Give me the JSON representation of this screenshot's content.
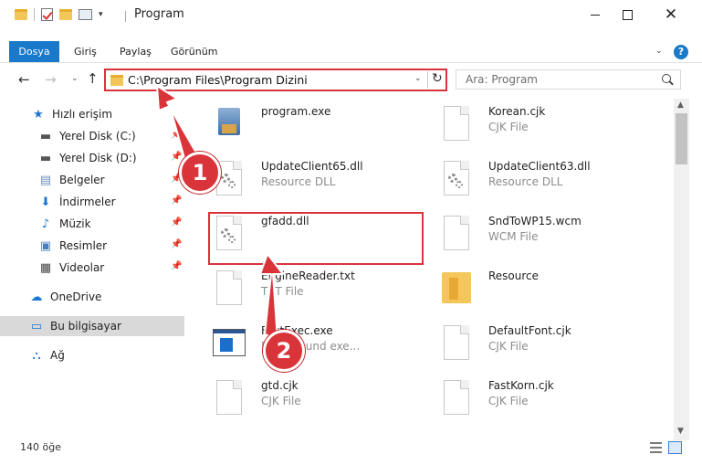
{
  "window": {
    "title": "Program",
    "controls": {
      "minimize": "minimize",
      "maximize": "maximize",
      "close": "✕"
    }
  },
  "ribbon": {
    "tabs": [
      "Dosya",
      "Giriş",
      "Paylaş",
      "Görünüm"
    ],
    "help": "?"
  },
  "address_bar": {
    "path": "C:\\Program Files\\Program Dizini",
    "search_placeholder": "Ara: Program"
  },
  "sidebar": {
    "items": [
      {
        "label": "Hızlı erişim",
        "icon": "star-icon",
        "pinned": false
      },
      {
        "label": "Yerel Disk (C:)",
        "icon": "drive-icon",
        "pinned": true
      },
      {
        "label": "Yerel Disk (D:)",
        "icon": "drive-icon",
        "pinned": true
      },
      {
        "label": "Belgeler",
        "icon": "documents-icon",
        "pinned": true
      },
      {
        "label": "İndirmeler",
        "icon": "download-icon",
        "pinned": true
      },
      {
        "label": "Müzik",
        "icon": "music-icon",
        "pinned": true
      },
      {
        "label": "Resimler",
        "icon": "pictures-icon",
        "pinned": true
      },
      {
        "label": "Videolar",
        "icon": "video-icon",
        "pinned": true
      },
      {
        "label": "OneDrive",
        "icon": "cloud-icon",
        "pinned": false
      },
      {
        "label": "Bu bilgisayar",
        "icon": "computer-icon",
        "pinned": false,
        "selected": true
      },
      {
        "label": "Ağ",
        "icon": "network-icon",
        "pinned": false
      }
    ]
  },
  "files": [
    {
      "name": "program.exe",
      "type": "",
      "icon": "app-icon"
    },
    {
      "name": "Korean.cjk",
      "type": "CJK File",
      "icon": "document-icon"
    },
    {
      "name": "UpdateClient65.dll",
      "type": "Resource DLL",
      "icon": "dll-icon"
    },
    {
      "name": "UpdateClient63.dll",
      "type": "Resource DLL",
      "icon": "dll-icon"
    },
    {
      "name": "gfadd.dll",
      "type": "",
      "icon": "dll-icon"
    },
    {
      "name": "SndToWP15.wcm",
      "type": "WCM File",
      "icon": "document-icon"
    },
    {
      "name": "EngineReader.txt",
      "type": "TXT File",
      "icon": "document-icon"
    },
    {
      "name": "Resource",
      "type": "",
      "icon": "folder-icon"
    },
    {
      "name": "FirstExec.exe",
      "type": "Background exe...",
      "icon": "exe-icon"
    },
    {
      "name": "DefaultFont.cjk",
      "type": "CJK File",
      "icon": "document-icon"
    },
    {
      "name": "gtd.cjk",
      "type": "CJK File",
      "icon": "document-icon"
    },
    {
      "name": "FastKorn.cjk",
      "type": "CJK File",
      "icon": "document-icon"
    }
  ],
  "callouts": [
    "1",
    "2"
  ],
  "status": {
    "count": "140 öğe"
  },
  "colors": {
    "accent": "#1979ca",
    "highlight": "#d9343a"
  }
}
